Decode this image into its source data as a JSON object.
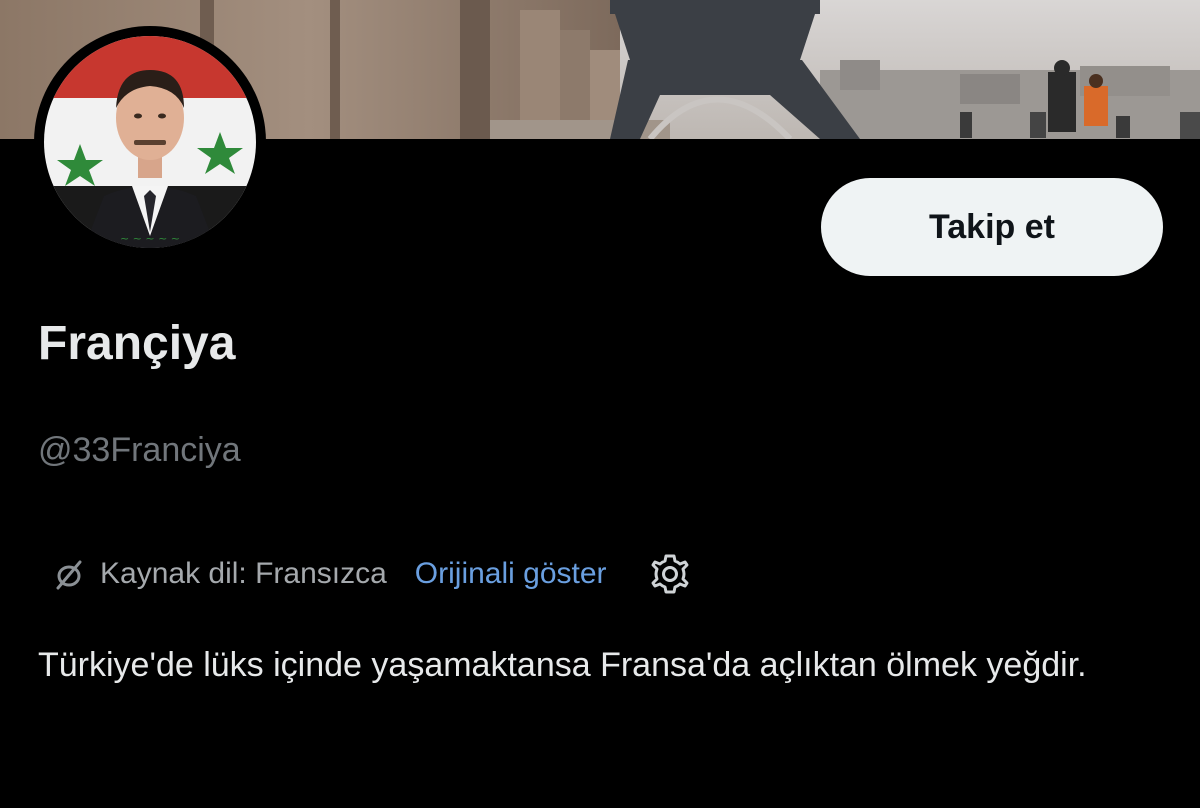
{
  "profile": {
    "display_name": "Françiya",
    "handle": "@33Franciya",
    "follow_label": "Takip et",
    "bio": "Türkiye'de lüks içinde yaşamaktansa Fransa'da açlıktan ölmek yeğdir."
  },
  "translation": {
    "source_label": "Kaynak dil: Fransızca",
    "show_original_label": "Orijinali göster"
  },
  "icons": {
    "translate": "translate-icon",
    "settings": "gear-icon"
  },
  "colors": {
    "background": "#000000",
    "text": "#e7e9ea",
    "muted": "#71767b",
    "link": "#6a9fe0",
    "button_bg": "#eff3f4"
  }
}
